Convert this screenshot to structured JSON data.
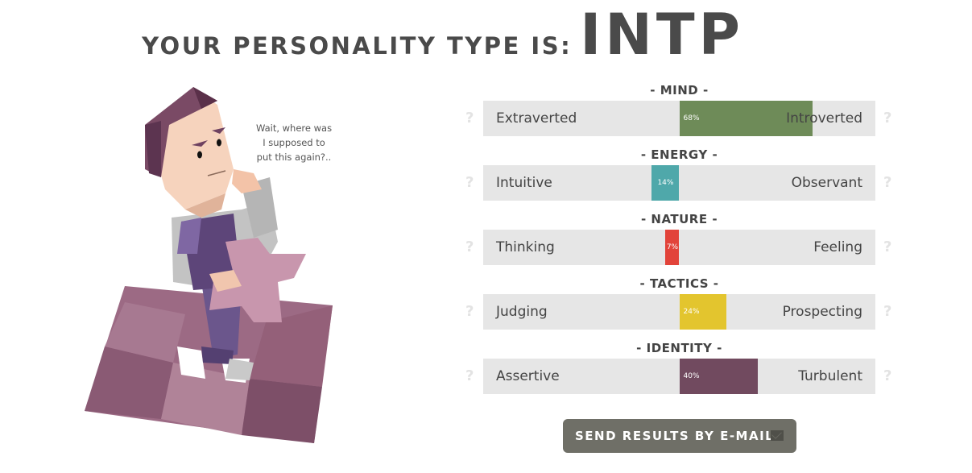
{
  "header": {
    "prefix": "YOUR PERSONALITY TYPE IS:",
    "type": "INTP"
  },
  "illustration": {
    "speech": [
      "Wait, where was",
      "I supposed to",
      "put this again?.."
    ]
  },
  "scales": [
    {
      "title": "- MIND -",
      "left": "Extraverted",
      "right": "Introverted",
      "percent": 68,
      "percent_label": "68%",
      "direction": "right",
      "color": "#6e8b58"
    },
    {
      "title": "- ENERGY -",
      "left": "Intuitive",
      "right": "Observant",
      "percent": 14,
      "percent_label": "14%",
      "direction": "left",
      "color": "#4fa8aa"
    },
    {
      "title": "- NATURE -",
      "left": "Thinking",
      "right": "Feeling",
      "percent": 7,
      "percent_label": "7%",
      "direction": "left",
      "color": "#e2433a"
    },
    {
      "title": "- TACTICS -",
      "left": "Judging",
      "right": "Prospecting",
      "percent": 24,
      "percent_label": "24%",
      "direction": "right",
      "color": "#e3c52e"
    },
    {
      "title": "- IDENTITY -",
      "left": "Assertive",
      "right": "Turbulent",
      "percent": 40,
      "percent_label": "40%",
      "direction": "right",
      "color": "#714a5f"
    }
  ],
  "help_icon": "?",
  "send_button": {
    "label": "SEND RESULTS BY E-MAIL",
    "icon": "envelope-icon"
  }
}
